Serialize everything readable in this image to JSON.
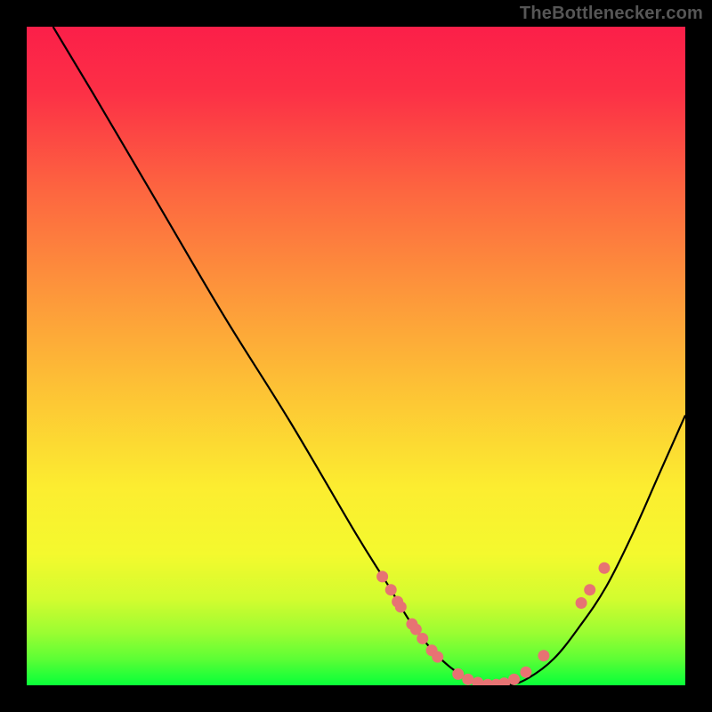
{
  "source_label": "TheBottlenecker.com",
  "colors": {
    "frame": "#000000",
    "curve": "#000000",
    "marker": "#e77373",
    "gradient_stops": [
      {
        "offset": 0.0,
        "color": "#fb1f49"
      },
      {
        "offset": 0.1,
        "color": "#fc3046"
      },
      {
        "offset": 0.25,
        "color": "#fd6640"
      },
      {
        "offset": 0.4,
        "color": "#fd953b"
      },
      {
        "offset": 0.55,
        "color": "#fdc235"
      },
      {
        "offset": 0.7,
        "color": "#fced30"
      },
      {
        "offset": 0.8,
        "color": "#f4f92e"
      },
      {
        "offset": 0.87,
        "color": "#d2fc2f"
      },
      {
        "offset": 0.92,
        "color": "#9bfd32"
      },
      {
        "offset": 0.96,
        "color": "#5dfe35"
      },
      {
        "offset": 0.985,
        "color": "#26ff38"
      },
      {
        "offset": 1.0,
        "color": "#0aff39"
      }
    ]
  },
  "chart_data": {
    "type": "line",
    "title": "",
    "xlabel": "",
    "ylabel": "",
    "xlim": [
      0,
      100
    ],
    "ylim": [
      0,
      100
    ],
    "series": [
      {
        "name": "bottleneck-curve",
        "x": [
          4,
          10,
          20,
          30,
          40,
          50,
          55,
          58,
          61,
          64,
          67,
          70,
          73,
          76,
          80,
          84,
          88,
          92,
          96,
          100
        ],
        "y": [
          100,
          90,
          73,
          56,
          40,
          23,
          15,
          10,
          6,
          3,
          1,
          0,
          0,
          1,
          4,
          9,
          15,
          23,
          32,
          41
        ]
      }
    ],
    "markers": {
      "name": "highlighted-points",
      "x": [
        54.0,
        55.3,
        56.3,
        56.8,
        58.5,
        59.1,
        60.1,
        61.5,
        62.4,
        65.5,
        67.0,
        68.5,
        70.0,
        71.3,
        72.5,
        74.0,
        75.8,
        78.5,
        84.2,
        85.5,
        87.7
      ],
      "y": [
        16.5,
        14.5,
        12.7,
        11.9,
        9.3,
        8.5,
        7.1,
        5.3,
        4.3,
        1.7,
        0.9,
        0.4,
        0.1,
        0.1,
        0.3,
        0.9,
        2.0,
        4.5,
        12.5,
        14.5,
        17.8
      ]
    }
  }
}
